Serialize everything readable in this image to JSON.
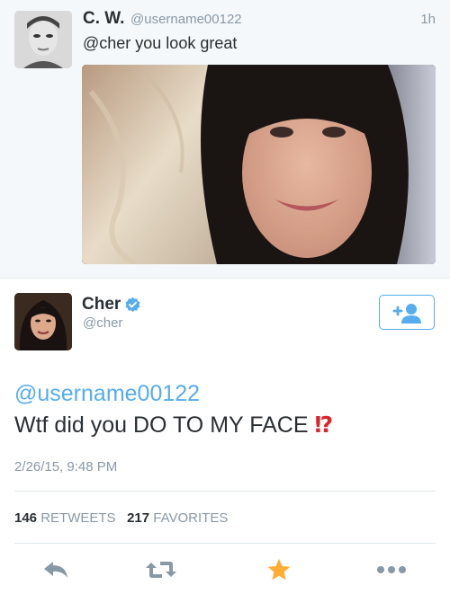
{
  "parent_tweet": {
    "name": "C. W.",
    "handle": "@username00122",
    "time": "1h",
    "text": "@cher you look great"
  },
  "main_tweet": {
    "name": "Cher",
    "handle": "@cher",
    "mention": "@username00122",
    "text": "Wtf did you DO TO MY FACE",
    "emoji": "⁉",
    "date": "2/26/15, 9:48 PM",
    "retweets_count": "146",
    "retweets_label": "RETWEETS",
    "favorites_count": "217",
    "favorites_label": "FAVORITES",
    "verified": true
  },
  "colors": {
    "link_blue": "#55acee",
    "muted_gray": "#8899a6",
    "text_dark": "#292f33",
    "favorite_gold": "#ffac33",
    "emoji_red": "#d8262f"
  },
  "icons": {
    "follow": "add-user-icon",
    "verified": "verified-badge-icon",
    "reply": "reply-icon",
    "retweet": "retweet-icon",
    "favorite": "star-icon",
    "more": "more-dots-icon"
  }
}
